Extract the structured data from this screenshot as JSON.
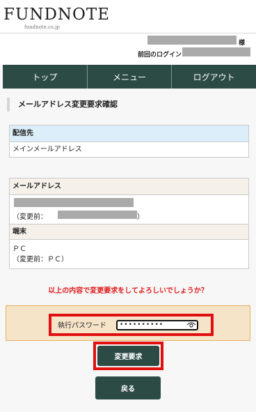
{
  "header": {
    "logo": "FUNDNOTE",
    "logo_sub": "fundnote.co.jp"
  },
  "user": {
    "name_suffix": "様",
    "last_login_label": "前回のログイン"
  },
  "nav": {
    "items": [
      {
        "label": "トップ"
      },
      {
        "label": "メニュー"
      },
      {
        "label": "ログアウト"
      }
    ]
  },
  "page_title": "メールアドレス変更要求確認",
  "delivery": {
    "heading": "配信先",
    "value": "メインメールアドレス"
  },
  "details": {
    "email_heading": "メールアドレス",
    "email_before_prefix": "（変更前：",
    "email_before_suffix": "）",
    "device_heading": "端末",
    "device_value": "ＰＣ",
    "device_before": "（変更前：ＰＣ）"
  },
  "confirm_question": "以上の内容で変更要求をしてよろしいでしょうか？",
  "password": {
    "label": "執行パスワード",
    "masked_value": "••••••••••"
  },
  "buttons": {
    "submit": "変更要求",
    "back": "戻る"
  },
  "colors": {
    "nav_bg": "#2d4b45",
    "highlight": "#e01010",
    "question": "#e01b1b"
  }
}
